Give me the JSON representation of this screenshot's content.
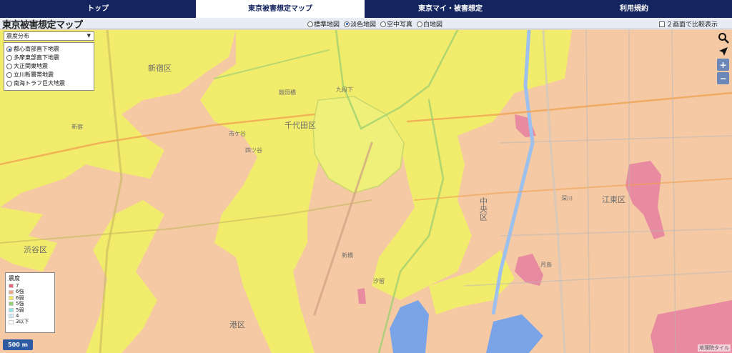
{
  "nav": {
    "tabs": [
      {
        "label": "トップ"
      },
      {
        "label": "東京被害想定マップ",
        "active": true
      },
      {
        "label": "東京マイ・被害想定"
      },
      {
        "label": "利用規約"
      }
    ]
  },
  "header": {
    "title": "東京被害想定マップ",
    "basemaps": [
      "標準地図",
      "淡色地図",
      "空中写真",
      "白地図"
    ],
    "selected_basemap": "淡色地図",
    "compare_label": "２画面で比較表示"
  },
  "panel": {
    "select_value": "震度分布",
    "scenarios": [
      "都心南部直下地震",
      "多摩東部直下地震",
      "大正関東地震",
      "立川断層帯地震",
      "南海トラフ巨大地震"
    ],
    "selected_scenario": "都心南部直下地震"
  },
  "legend": {
    "title": "震度",
    "items": [
      {
        "label": "7",
        "color": "#e8647a"
      },
      {
        "label": "6強",
        "color": "#f0a888"
      },
      {
        "label": "6弱",
        "color": "#f4e860"
      },
      {
        "label": "5強",
        "color": "#8ed070"
      },
      {
        "label": "5弱",
        "color": "#8ee8e8"
      },
      {
        "label": "4",
        "color": "#cfe8f8"
      },
      {
        "label": "3以下",
        "color": "#ffffff"
      }
    ]
  },
  "scale_label": "500 m",
  "attribution": "地理院タイル",
  "map_labels": [
    "新宿区",
    "千代田区",
    "中央区",
    "江東区",
    "渋谷区",
    "港区",
    "新宿",
    "市ケ谷",
    "四ツ谷",
    "飯田橋",
    "九段下",
    "新橋",
    "月島",
    "汐留",
    "深川"
  ],
  "colors": {
    "nav_bg": "#13245e",
    "intensity_6_upper": "#f4c49c",
    "intensity_6_lower": "#f2ee6a",
    "intensity_7": "#e88aa0",
    "water": "#7aa4e8"
  }
}
